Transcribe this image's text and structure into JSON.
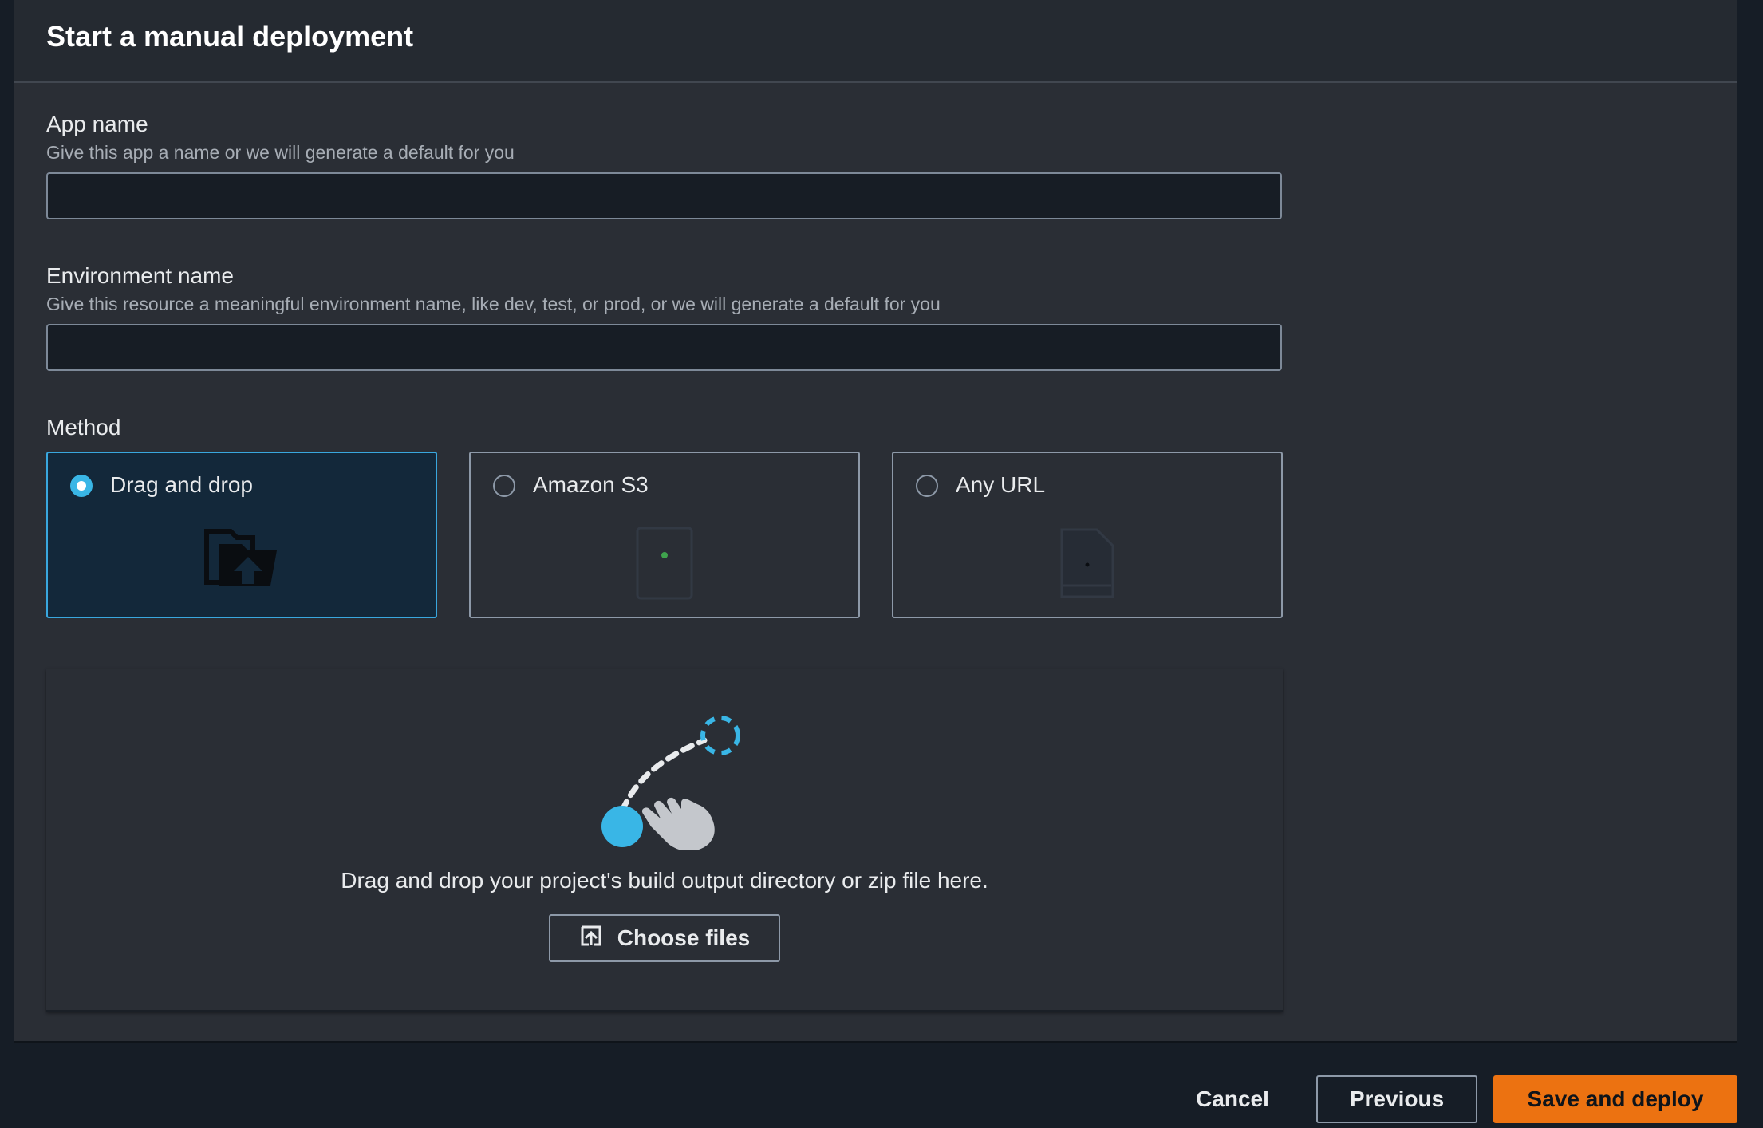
{
  "panel": {
    "title": "Start a manual deployment"
  },
  "app_name": {
    "label": "App name",
    "description": "Give this app a name or we will generate a default for you",
    "value": ""
  },
  "environment_name": {
    "label": "Environment name",
    "description": "Give this resource a meaningful environment name, like dev, test, or prod, or we will generate a default for you",
    "value": ""
  },
  "method": {
    "label": "Method",
    "selected": "Drag and drop",
    "options": [
      {
        "label": "Drag and drop",
        "icon": "folder-upload-icon",
        "selected": true
      },
      {
        "label": "Amazon S3",
        "icon": "s3-bucket-icon",
        "selected": false
      },
      {
        "label": "Any URL",
        "icon": "url-file-icon",
        "selected": false
      }
    ]
  },
  "dropzone": {
    "text": "Drag and drop your project's build output directory or zip file here.",
    "choose_files_label": "Choose files",
    "illustration": "drag-gesture-icon"
  },
  "footer": {
    "cancel_label": "Cancel",
    "previous_label": "Previous",
    "save_label": "Save and deploy"
  },
  "colors": {
    "accent": "#39b6e6",
    "primary_button": "#ec7211",
    "panel_bg": "#2a2e35",
    "page_bg": "#161d26"
  }
}
